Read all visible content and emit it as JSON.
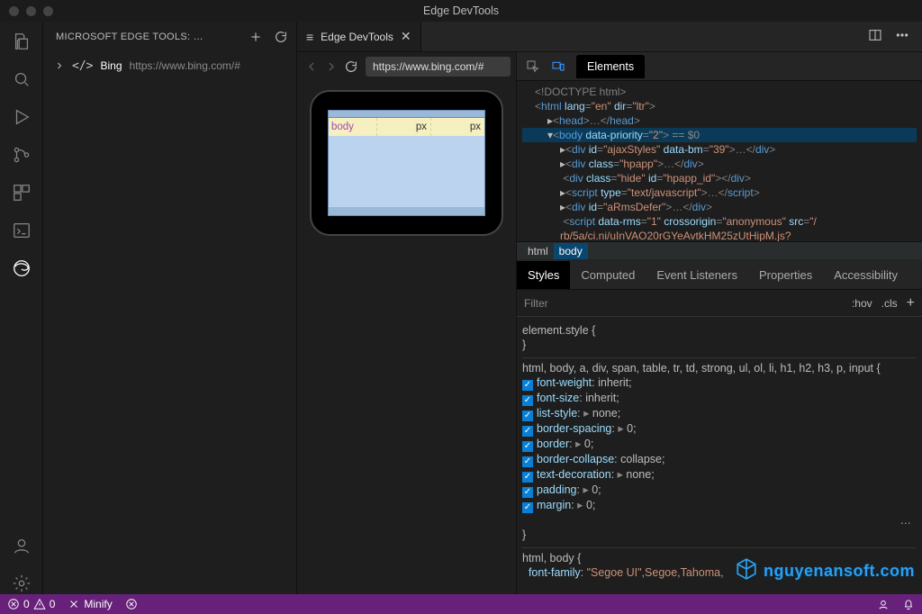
{
  "titlebar": {
    "title": "Edge DevTools"
  },
  "sidebar": {
    "header_label": "MICROSOFT EDGE TOOLS: …",
    "tree": {
      "name": "Bing",
      "url": "https://www.bing.com/#"
    }
  },
  "tab": {
    "label": "Edge DevTools"
  },
  "preview": {
    "address": "https://www.bing.com/#",
    "overlay": {
      "c1": "body",
      "c2": "px",
      "c3": "px"
    }
  },
  "devtools": {
    "panel_tab": "Elements",
    "dom": {
      "l0": "<!DOCTYPE html>",
      "l1_open": "<html ",
      "l1_a1": "lang",
      "l1_v1": "\"en\"",
      "l1_a2": "dir",
      "l1_v2": "\"ltr\"",
      "l1_close": ">",
      "l2": "<head>",
      "l2_ell": "…",
      "l2_end": "</head>",
      "l3_open": "<body ",
      "l3_a1": "data-priority",
      "l3_v1": "\"2\"",
      "l3_close": ">",
      "l3_suffix": " == $0",
      "l4_open": "<div ",
      "l4_a1": "id",
      "l4_v1": "\"ajaxStyles\"",
      "l4_a2": "data-bm",
      "l4_v2": "\"39\"",
      "l4_close": ">",
      "l4_ell": "…",
      "l4_end": "</div>",
      "l5_open": "<div ",
      "l5_a1": "class",
      "l5_v1": "\"hpapp\"",
      "l5_close": ">",
      "l5_ell": "…",
      "l5_end": "</div>",
      "l6_open": "<div ",
      "l6_a1": "class",
      "l6_v1": "\"hide\"",
      "l6_a2": "id",
      "l6_v2": "\"hpapp_id\"",
      "l6_close": ">",
      "l6_end": "</div>",
      "l7_open": "<script ",
      "l7_a1": "type",
      "l7_v1": "\"text/javascript\"",
      "l7_close": ">",
      "l7_ell": "…",
      "l7_end": "</script>",
      "l8_open": "<div ",
      "l8_a1": "id",
      "l8_v1": "\"aRmsDefer\"",
      "l8_close": ">",
      "l8_ell": "…",
      "l8_end": "</div>",
      "l9_open": "<script ",
      "l9_a1": "data-rms",
      "l9_v1": "\"1\"",
      "l9_a2": "crossorigin",
      "l9_v2": "\"anonymous\"",
      "l9_a3": "src",
      "l9_v3": "\"/",
      "l10": "rb/5a/ci.ni/uInVAO20rGYeAvtkHM25zUtHipM.js?"
    },
    "breadcrumb": {
      "b0": "html",
      "b1": "body"
    }
  },
  "styles": {
    "tabs": {
      "t0": "Styles",
      "t1": "Computed",
      "t2": "Event Listeners",
      "t3": "Properties",
      "t4": "Accessibility"
    },
    "filter_placeholder": "Filter",
    "hov": ":hov",
    "cls": ".cls",
    "rule0": {
      "sel": "element.style {",
      "close": "}"
    },
    "rule1": {
      "sel": "html, body, a, div, span, table, tr, td, strong, ul, ol, li, h1, h2, h3, p, input {",
      "p0": "font-weight",
      "v0": "inherit",
      "p1": "font-size",
      "v1": "inherit",
      "p2": "list-style",
      "v2": "none",
      "p3": "border-spacing",
      "v3": "0",
      "p4": "border",
      "v4": "0",
      "p5": "border-collapse",
      "v5": "collapse",
      "p6": "text-decoration",
      "v6": "none",
      "p7": "padding",
      "v7": "0",
      "p8": "margin",
      "v8": "0",
      "close": "}"
    },
    "rule2": {
      "sel": "html, body {",
      "p0": "font-family",
      "v0": "\"Segoe UI\",Segoe,Tahoma,"
    }
  },
  "status": {
    "errors": "0",
    "warnings": "0",
    "minify": "Minify"
  },
  "watermark": "nguyenansoft.com"
}
